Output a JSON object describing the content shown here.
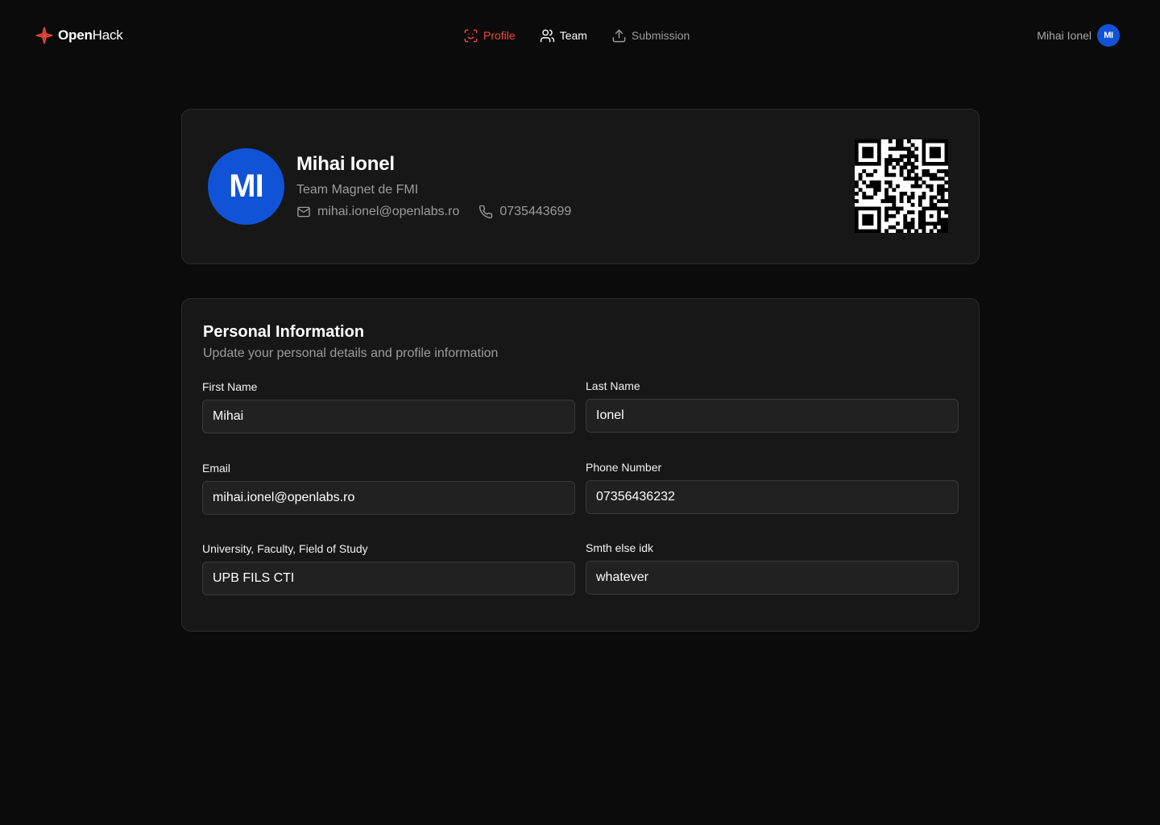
{
  "app": {
    "brand_first": "Open",
    "brand_second": "Hack",
    "brand_color": "#f04a3a"
  },
  "nav": {
    "items": [
      {
        "label": "Profile",
        "icon": "scan-face-icon",
        "state": "active"
      },
      {
        "label": "Team",
        "icon": "users-icon",
        "state": "default"
      },
      {
        "label": "Submission",
        "icon": "upload-icon",
        "state": "muted"
      }
    ],
    "active_color": "#f04a3a"
  },
  "user_chip": {
    "name": "Mihai Ionel",
    "initials": "MI",
    "avatar_color": "#1153d6"
  },
  "profile_card": {
    "initials": "MI",
    "name": "Mihai Ionel",
    "team": "Team Magnet de FMI",
    "email": "mihai.ionel@openlabs.ro",
    "phone": "0735443699",
    "email_icon": "mail-icon",
    "phone_icon": "phone-icon",
    "qr_icon": "qr-code"
  },
  "personal_info": {
    "title": "Personal Information",
    "subtitle": "Update your personal details and profile information",
    "fields": [
      {
        "label": "First Name",
        "value": "Mihai"
      },
      {
        "label": "Last Name",
        "value": "Ionel"
      },
      {
        "label": "Email",
        "value": "mihai.ionel@openlabs.ro"
      },
      {
        "label": "Phone Number",
        "value": "07356436232"
      },
      {
        "label": "University, Faculty, Field of Study",
        "value": "UPB FILS CTI"
      },
      {
        "label": "Smth else idk",
        "value": "whatever"
      }
    ]
  }
}
